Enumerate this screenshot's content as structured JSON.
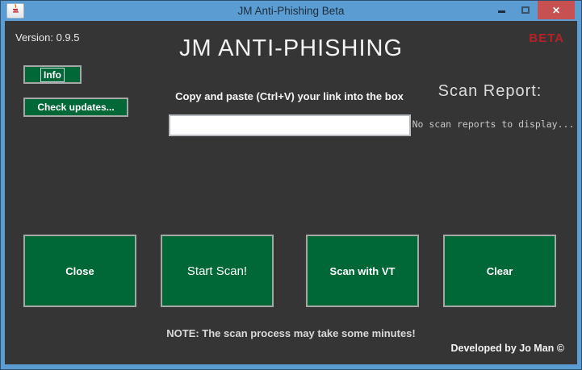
{
  "window": {
    "title": "JM Anti-Phishing Beta",
    "version_label": "Version: 0.9.5",
    "beta_badge": "BETA",
    "app_title": "JM ANTI-PHISHING"
  },
  "toolbar": {
    "info_label": "Info",
    "check_updates_label": "Check updates..."
  },
  "scan": {
    "instruction": "Copy and paste (Ctrl+V) your link into the box",
    "link_input_value": "",
    "report_heading": "Scan Report:",
    "report_empty_text": "No scan reports to display..."
  },
  "actions": {
    "close_label": "Close",
    "start_scan_label": "Start Scan!",
    "scan_vt_label": "Scan with VT",
    "clear_label": "Clear"
  },
  "footer": {
    "note": "NOTE: The scan process may take some minutes!",
    "credit": "Developed by Jo Man ©"
  },
  "icons": {
    "java_icon": "java-coffee-cup",
    "minimize_icon": "minimize",
    "maximize_icon": "maximize",
    "close_glyph": "✕"
  },
  "colors": {
    "titlebar_blue": "#5b9cd2",
    "window_background": "#353535",
    "button_green": "#006837",
    "close_button_red": "#c75050",
    "beta_red": "#b92025"
  }
}
